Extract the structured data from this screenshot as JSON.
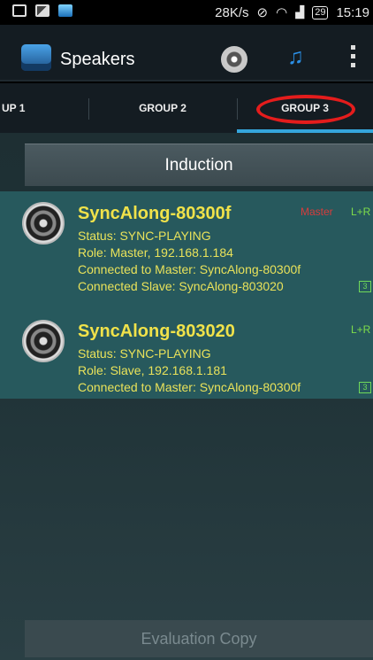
{
  "status_bar": {
    "net_speed": "28K/s",
    "battery_level": "29",
    "time": "15:19",
    "icons": [
      "mail-icon",
      "image-icon",
      "app-icon",
      "mute-icon",
      "wifi-icon",
      "signal-icon",
      "battery-icon"
    ]
  },
  "action_bar": {
    "title": "Speakers",
    "icons": [
      "speaker-icon",
      "music-icon",
      "overflow-menu-icon"
    ]
  },
  "tabs": [
    {
      "label": "UP 1"
    },
    {
      "label": "GROUP 2"
    },
    {
      "label": "GROUP 3"
    }
  ],
  "induction_label": "Induction",
  "speakers": [
    {
      "name": "SyncAlong-80300f",
      "role_badge": "Master",
      "channel": "L+R",
      "channel_badge": "3",
      "status": "Status: SYNC-PLAYING",
      "role": "Role: Master,  192.168.1.184",
      "connected_master": "Connected to Master: SyncAlong-80300f",
      "connected_slave": "Connected Slave: SyncAlong-803020"
    },
    {
      "name": "SyncAlong-803020",
      "channel": "L+R",
      "channel_badge": "3",
      "status": "Status: SYNC-PLAYING",
      "role": "Role: Slave,  192.168.1.181",
      "connected_master": "Connected to Master: SyncAlong-80300f"
    }
  ],
  "evaluation_label": "Evaluation Copy",
  "colors": {
    "accent": "#35a6dc",
    "speaker_name": "#f0e24a",
    "master_badge": "#d73c3c",
    "channel": "#7edc4a",
    "selected_tab_mark": "#e41c1c"
  }
}
